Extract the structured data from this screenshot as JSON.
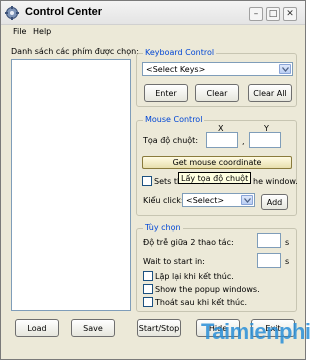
{
  "window": {
    "title": "Control Center",
    "icons": {
      "app": "gear-icon",
      "minimize": "minimize-icon",
      "maximize": "maximize-icon",
      "close": "close-icon"
    }
  },
  "menu": {
    "file": "File",
    "help": "Help"
  },
  "keys_list": {
    "label": "Danh sách các phím được chọn:"
  },
  "keyboard": {
    "title": "Keyboard Control",
    "select_value": "<Select Keys>",
    "enter": "Enter",
    "clear": "Clear",
    "clear_all": "Clear All"
  },
  "mouse": {
    "title": "Mouse Control",
    "coord_label": "Tọa độ chuột:",
    "x_label": "X",
    "y_label": "Y",
    "separator": ",",
    "x_value": "",
    "y_value": "",
    "get_coord": "Get mouse coordinate",
    "tooltip": "Lấy tọa độ chuột",
    "sets_label_left": "Sets the",
    "sets_label_right": "he window.",
    "click_label": "Kiểu click:",
    "click_value": "<Select>",
    "add": "Add"
  },
  "options": {
    "title": "Tùy chọn",
    "delay_label": "Độ trễ giữa 2 thao tác:",
    "delay_unit": "s",
    "delay_value": "",
    "wait_label": "Wait to start in:",
    "wait_unit": "s",
    "wait_value": "",
    "repeat_label": "Lặp lại khi kết thúc.",
    "popup_label": "Show the popup windows.",
    "exit_label": "Thoát sau khi kết thúc."
  },
  "footer": {
    "load": "Load",
    "save": "Save",
    "start_stop": "Start/Stop",
    "hide": "Hide",
    "exit": "Exit"
  },
  "watermark": {
    "text": "Taimienphi"
  },
  "colors": {
    "group_title": "#0046d5",
    "background": "#ece9d8",
    "watermark": "#2a8fd8"
  }
}
